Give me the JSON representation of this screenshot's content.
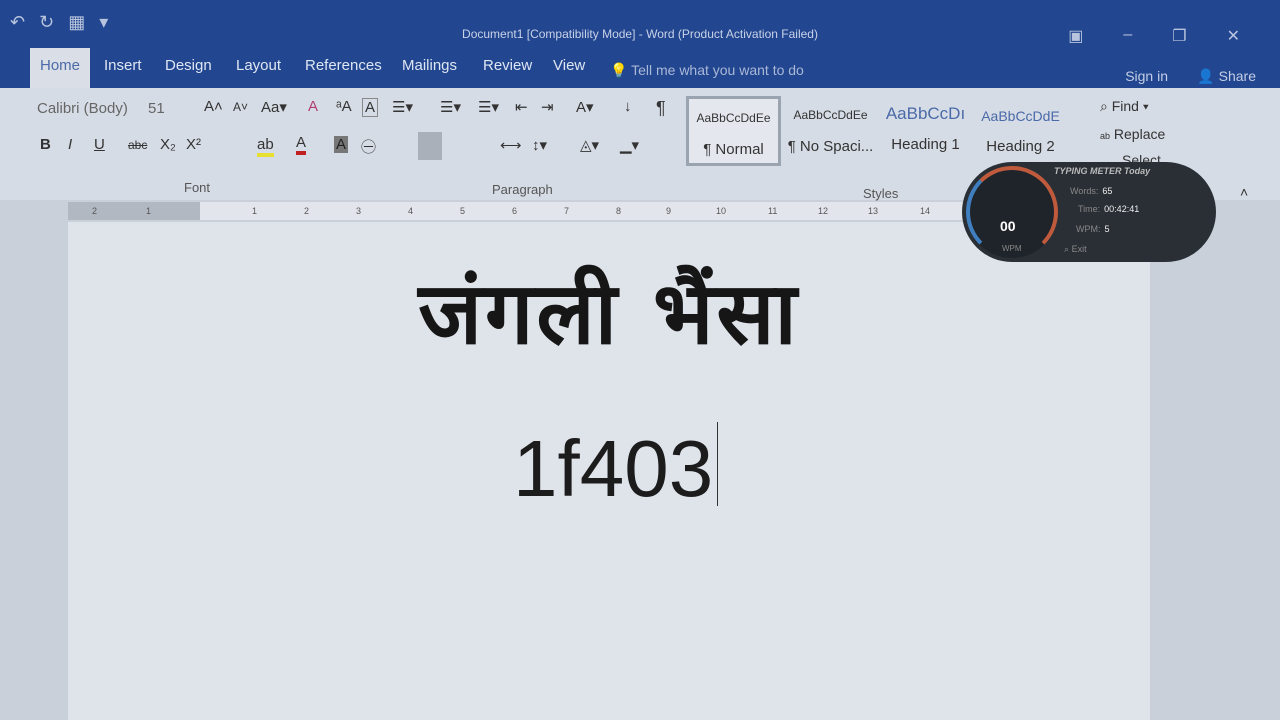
{
  "titlebar": {
    "title": "Document1 [Compatibility Mode] - Word (Product Activation Failed)",
    "qat": [
      "↶",
      "↻",
      "▦",
      "▾"
    ]
  },
  "tabs": [
    "Home",
    "Insert",
    "Design",
    "Layout",
    "References",
    "Mailings",
    "Review",
    "View"
  ],
  "tell_me": "Tell me what you want to do",
  "sign_in": "Sign in",
  "share": "Share",
  "font": {
    "name": "Calibri (Body)",
    "size": "51",
    "group_label": "Font"
  },
  "paragraph": {
    "group_label": "Paragraph"
  },
  "styles": {
    "group_label": "Styles",
    "items": [
      {
        "preview": "AaBbCcDdEe",
        "name": "¶ Normal"
      },
      {
        "preview": "AaBbCcDdEe",
        "name": "¶ No Spaci..."
      },
      {
        "preview": "AaBbCcDı",
        "name": "Heading 1"
      },
      {
        "preview": "AaBbCcDdE",
        "name": "Heading 2"
      }
    ]
  },
  "editing": {
    "find": "Find",
    "replace": "Replace",
    "select": "Select"
  },
  "ruler": [
    "2",
    "1",
    "1",
    "2",
    "3",
    "4",
    "5",
    "6",
    "7",
    "8",
    "9",
    "10",
    "11",
    "12",
    "13",
    "14"
  ],
  "document": {
    "line1": "जंगली भैंसा",
    "line2": "1f403"
  },
  "typing_meter": {
    "title": "TYPING METER Today",
    "words_label": "Words:",
    "words": "65",
    "time_label": "Time:",
    "time": "00:42:41",
    "wpm_label": "WPM:",
    "wpm": "5",
    "gauge_value": "00",
    "gauge_unit": "WPM",
    "exit": "Exit"
  }
}
